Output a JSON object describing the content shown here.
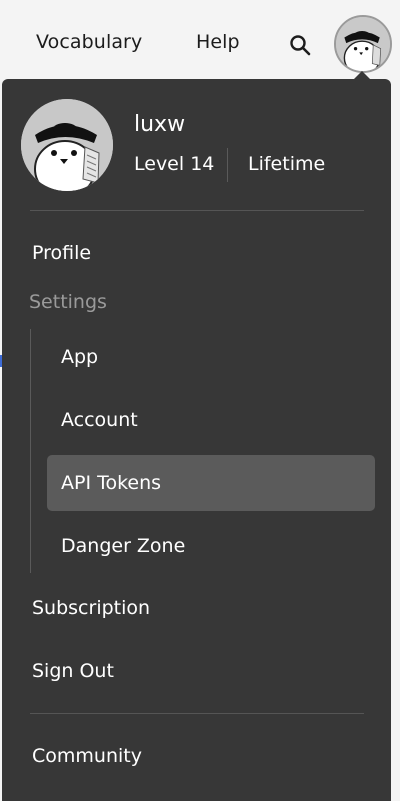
{
  "topbar": {
    "vocabulary_label": "Vocabulary",
    "help_label": "Help",
    "search_icon": "search-icon"
  },
  "user": {
    "username": "luxw",
    "level": "Level 14",
    "plan": "Lifetime"
  },
  "menu": {
    "profile": "Profile",
    "settings_heading": "Settings",
    "settings_items": [
      "App",
      "Account",
      "API Tokens",
      "Danger Zone"
    ],
    "selected_item": "API Tokens",
    "subscription": "Subscription",
    "sign_out": "Sign Out",
    "community": "Community"
  },
  "colors": {
    "menu_bg": "#373737",
    "selected_bg": "#5b5b5b",
    "muted_text": "#9a9a9a",
    "topbar_bg": "#f4f4f4"
  }
}
